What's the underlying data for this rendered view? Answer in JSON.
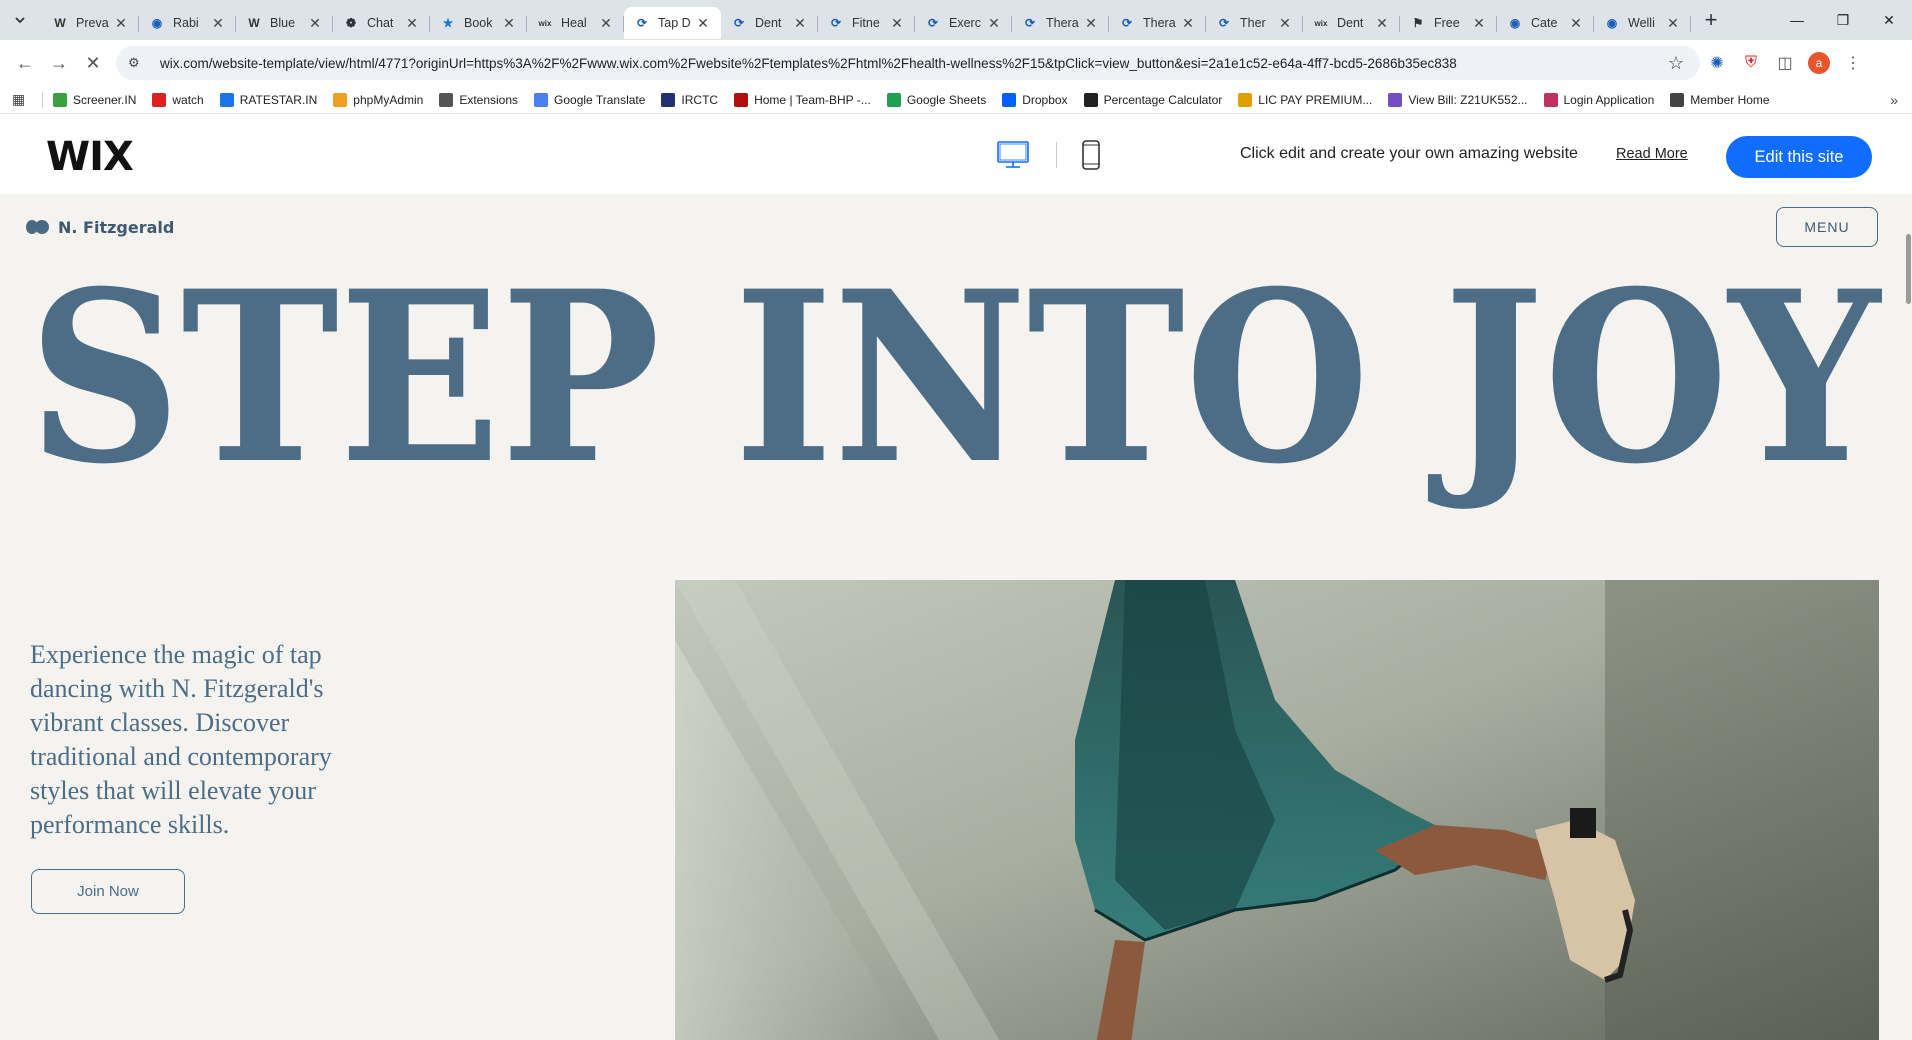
{
  "browser": {
    "tabs": [
      {
        "title": "Preva",
        "icon": "wikipedia-icon"
      },
      {
        "title": "Rabi",
        "icon": "globe-icon"
      },
      {
        "title": "Blue",
        "icon": "wikipedia-icon"
      },
      {
        "title": "Chat",
        "icon": "chatgpt-icon"
      },
      {
        "title": "Book",
        "icon": "star-icon"
      },
      {
        "title": "Heal",
        "icon": "wix-icon"
      },
      {
        "title": "Tap D",
        "icon": "loading-icon"
      },
      {
        "title": "Dent",
        "icon": "loading-icon"
      },
      {
        "title": "Fitne",
        "icon": "loading-icon"
      },
      {
        "title": "Exerc",
        "icon": "loading-icon"
      },
      {
        "title": "Thera",
        "icon": "loading-icon"
      },
      {
        "title": "Thera",
        "icon": "loading-icon"
      },
      {
        "title": "Ther",
        "icon": "loading-icon"
      },
      {
        "title": "Dent",
        "icon": "wix-icon"
      },
      {
        "title": "Free",
        "icon": "flag-icon"
      },
      {
        "title": "Cate",
        "icon": "globe-icon"
      },
      {
        "title": "Welli",
        "icon": "globe-icon"
      }
    ],
    "url": "wix.com/website-template/view/html/4771?originUrl=https%3A%2F%2Fwww.wix.com%2Fwebsite%2Ftemplates%2Fhtml%2Fhealth-wellness%2F15&tpClick=view_button&esi=2a1e1c52-e64a-4ff7-bcd5-2686b35ec838",
    "avatar_letter": "a",
    "bookmarks": [
      {
        "label": "Screener.IN",
        "color": "#3aa040"
      },
      {
        "label": "watch",
        "color": "#e02020"
      },
      {
        "label": "RATESTAR.IN",
        "color": "#1a73e8"
      },
      {
        "label": "phpMyAdmin",
        "color": "#f0a020"
      },
      {
        "label": "Extensions",
        "color": "#555555"
      },
      {
        "label": "Google Translate",
        "color": "#4a80f0"
      },
      {
        "label": "IRCTC",
        "color": "#203070"
      },
      {
        "label": "Home | Team-BHP -...",
        "color": "#b01010"
      },
      {
        "label": "Google Sheets",
        "color": "#20a050"
      },
      {
        "label": "Dropbox",
        "color": "#0061fe"
      },
      {
        "label": "Percentage Calculator",
        "color": "#222222"
      },
      {
        "label": "LIC PAY PREMIUM...",
        "color": "#e0a000"
      },
      {
        "label": "View Bill: Z21UK552...",
        "color": "#7050c0"
      },
      {
        "label": "Login Application",
        "color": "#c03060"
      },
      {
        "label": "Member Home",
        "color": "#444444"
      }
    ]
  },
  "wix": {
    "logo": "WIX",
    "message": "Click edit and create your own amazing website",
    "read_more": "Read More",
    "edit_button": "Edit this site"
  },
  "site": {
    "brand": "N. Fitzgerald",
    "menu_label": "MENU",
    "headline": "STEP INTO JOY",
    "intro": "Experience the magic of tap dancing with N. Fitzgerald's vibrant classes. Discover traditional and contemporary styles that will elevate your performance skills.",
    "cta": "Join Now"
  },
  "colors": {
    "accent": "#116dff",
    "site_text": "#4d6d87",
    "site_bg": "#f4f3ef"
  }
}
